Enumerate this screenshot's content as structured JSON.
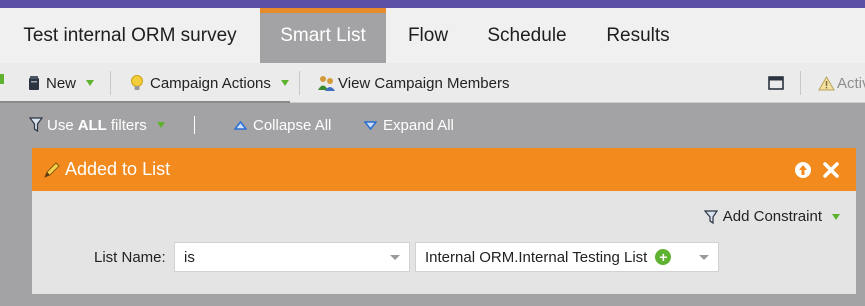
{
  "tabs": [
    {
      "label": "Test internal ORM survey",
      "active": false
    },
    {
      "label": "Smart List",
      "active": true
    },
    {
      "label": "Flow",
      "active": false
    },
    {
      "label": "Schedule",
      "active": false
    },
    {
      "label": "Results",
      "active": false
    }
  ],
  "toolbar": {
    "new_label": "New",
    "campaign_actions_label": "Campaign Actions",
    "view_members_label": "View Campaign Members",
    "active_label": "Activ"
  },
  "filterbar": {
    "use_prefix": "Use",
    "use_all": "ALL",
    "use_suffix": "filters",
    "collapse_label": "Collapse All",
    "expand_label": "Expand All",
    "separator": "|"
  },
  "filter_card": {
    "title": "Added to List",
    "add_constraint_label": "Add Constraint",
    "field_label": "List Name:",
    "operator_value": "is",
    "list_value": "Internal ORM.Internal Testing List"
  },
  "colors": {
    "accent_orange": "#f28a1d",
    "tab_active_top": "#e78b2a",
    "top_strip": "#5b50a6",
    "green": "#5fb230",
    "link_blue": "#2a6ed1"
  }
}
